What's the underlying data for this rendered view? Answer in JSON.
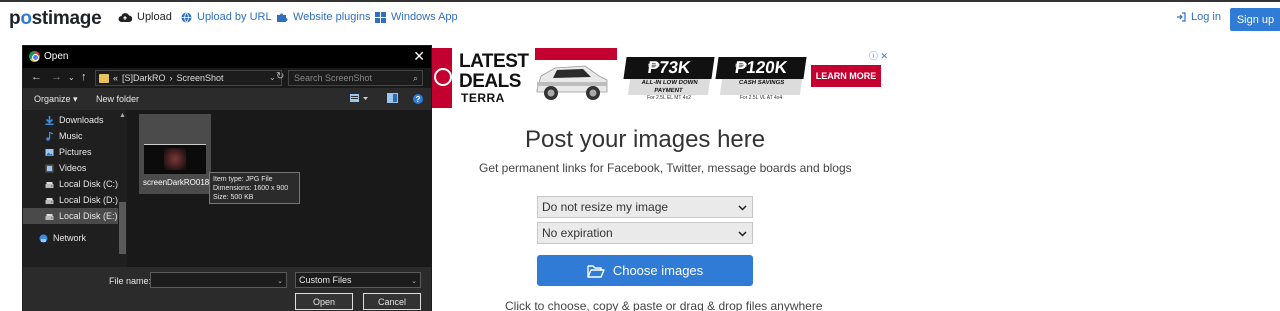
{
  "site": {
    "logo_text": "postimage",
    "nav": {
      "upload": "Upload",
      "upload_url": "Upload by URL",
      "plugins": "Website plugins",
      "windows_app": "Windows App",
      "login": "Log in",
      "signup": "Sign up"
    },
    "accent_color": "#2f7bd6"
  },
  "ad": {
    "headline": "LATEST DEALS",
    "model": "TERRA",
    "offers": [
      {
        "price": "₱73K",
        "label": "ALL-IN LOW DOWN PAYMENT",
        "note": "For 2.5L EL MT 4x2"
      },
      {
        "price": "₱120K",
        "label": "CASH SAVINGS",
        "note": "For 2.5L VL AT 4x4"
      }
    ],
    "cta": "LEARN MORE",
    "info": "ⓘ ✕"
  },
  "main": {
    "title": "Post your images here",
    "subtitle": "Get permanent links for Facebook, Twitter, message boards and blogs",
    "resize_select": "Do not resize my image",
    "expiration_select": "No expiration",
    "choose_button": "Choose images",
    "hint": "Click to choose, copy & paste or drag & drop files anywhere"
  },
  "dialog": {
    "title": "Open",
    "close": "✕",
    "path": [
      "«",
      "[S]DarkRO",
      "›",
      "ScreenShot"
    ],
    "search_placeholder": "Search ScreenShot",
    "organize": "Organize ▾",
    "new_folder": "New folder",
    "tree": [
      {
        "label": "Downloads",
        "icon": "download-icon"
      },
      {
        "label": "Music",
        "icon": "music-icon"
      },
      {
        "label": "Pictures",
        "icon": "pictures-icon"
      },
      {
        "label": "Videos",
        "icon": "videos-icon"
      },
      {
        "label": "Local Disk (C:)",
        "icon": "disk-icon"
      },
      {
        "label": "Local Disk (D:)",
        "icon": "disk-icon"
      },
      {
        "label": "Local Disk (E:)",
        "icon": "disk-icon",
        "selected": true
      },
      {
        "label": "Network",
        "icon": "network-icon"
      }
    ],
    "file": {
      "name": "screenDarkRO018",
      "tooltip": [
        "Item type: JPG File",
        "Dimensions: 1600 x 900",
        "Size: 500 KB"
      ]
    },
    "file_name_label": "File name:",
    "file_name_value": "",
    "file_type": "Custom Files",
    "open_button": "Open",
    "cancel_button": "Cancel"
  }
}
